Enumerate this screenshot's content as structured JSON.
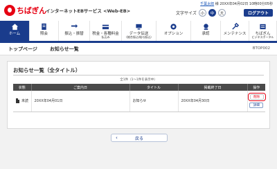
{
  "header": {
    "logo_text": "ちばぎん",
    "service_name": "インターネットEBサービス <Web-EB>",
    "user_name": "千葉太郎",
    "user_suffix": "様",
    "last_login": "20XX年04月02日 10時00分05秒",
    "font_size_label": "文字サイズ",
    "font_sizes": [
      "小",
      "中",
      "大"
    ],
    "font_size_selected": "中",
    "logout_label": "ログアウト"
  },
  "nav": {
    "items": [
      {
        "label": "ホーム",
        "sub": "",
        "icon": "home-icon",
        "active": true
      },
      {
        "label": "照会",
        "sub": "",
        "icon": "inquiry-icon",
        "active": false
      },
      {
        "label": "振込・振替",
        "sub": "",
        "icon": "transfer-icon",
        "active": false
      },
      {
        "label": "税金・各種料金",
        "sub": "払込み",
        "icon": "tax-payment-icon",
        "active": false
      },
      {
        "label": "データ伝送",
        "sub": "(総合振込/給与振込)",
        "icon": "data-transmission-icon",
        "active": false
      },
      {
        "label": "オプション",
        "sub": "",
        "icon": "option-icon",
        "active": false
      },
      {
        "label": "承認",
        "sub": "",
        "icon": "approval-icon",
        "active": false
      },
      {
        "label": "メンテナンス",
        "sub": "",
        "icon": "maintenance-icon",
        "active": false
      },
      {
        "label": "ちばぎん",
        "sub": "ビジネスポータル",
        "icon": "business-portal-icon",
        "active": false
      }
    ]
  },
  "breadcrumb": {
    "items": [
      "トップページ",
      "お知らせ一覧"
    ],
    "screen_id": "BTOP002"
  },
  "panel": {
    "title": "お知らせ一覧（全タイトル）",
    "count_text": "全1件（1～1件を表示中）",
    "columns": [
      "状態",
      "ご案内日",
      "タイトル",
      "掲載終了日",
      "操作"
    ],
    "rows": [
      {
        "status": "未読",
        "date": "20XX年04月01日",
        "title": "お知らせ",
        "end_date": "20XX年04月30日",
        "delete_label": "削除",
        "detail_label": "詳細"
      }
    ]
  },
  "back_label": "戻る",
  "colors": {
    "brand_red": "#e60012",
    "navy": "#1a3c8c",
    "table_header": "#4a4a4a"
  }
}
